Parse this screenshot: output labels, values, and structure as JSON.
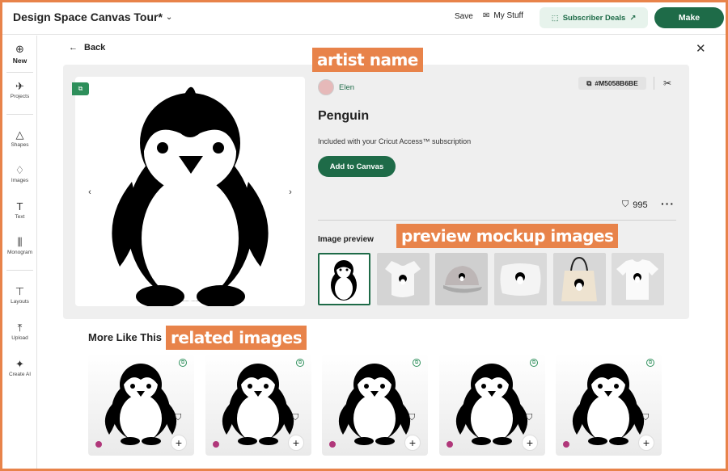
{
  "header": {
    "title": "Design Space Canvas Tour*",
    "save_label": "Save",
    "mystuff_label": "My Stuff",
    "subscriber_label": "Subscriber Deals",
    "make_label": "Make"
  },
  "sidebar": {
    "items": [
      {
        "label": "New",
        "icon": "plus-circle-icon"
      },
      {
        "label": "Projects",
        "icon": "projects-icon"
      },
      {
        "label": "Shapes",
        "icon": "shapes-icon"
      },
      {
        "label": "Images",
        "icon": "images-icon"
      },
      {
        "label": "Text",
        "icon": "text-icon"
      },
      {
        "label": "Monogram",
        "icon": "monogram-icon"
      },
      {
        "label": "Layouts",
        "icon": "layouts-icon"
      },
      {
        "label": "Upload",
        "icon": "upload-icon"
      },
      {
        "label": "Create AI",
        "icon": "sparkle-icon"
      }
    ]
  },
  "detail": {
    "back_label": "Back",
    "artist": "Elen",
    "image_id": "#M5058B6BE",
    "title": "Penguin",
    "subscription_text": "Included with your Cricut Access™ subscription",
    "add_button": "Add to Canvas",
    "save_count": "995",
    "preview_label": "Image preview",
    "previews": [
      "penguin image",
      "baby bodysuit",
      "cap",
      "pillow",
      "tote bag",
      "t-shirt"
    ]
  },
  "related": {
    "title": "More Like This",
    "count": 5
  },
  "annotations": {
    "artist": "artist name",
    "preview": "preview mockup images",
    "related": "related images"
  },
  "colors": {
    "brand_green": "#1e6b48",
    "callout_orange": "#e8834a"
  }
}
